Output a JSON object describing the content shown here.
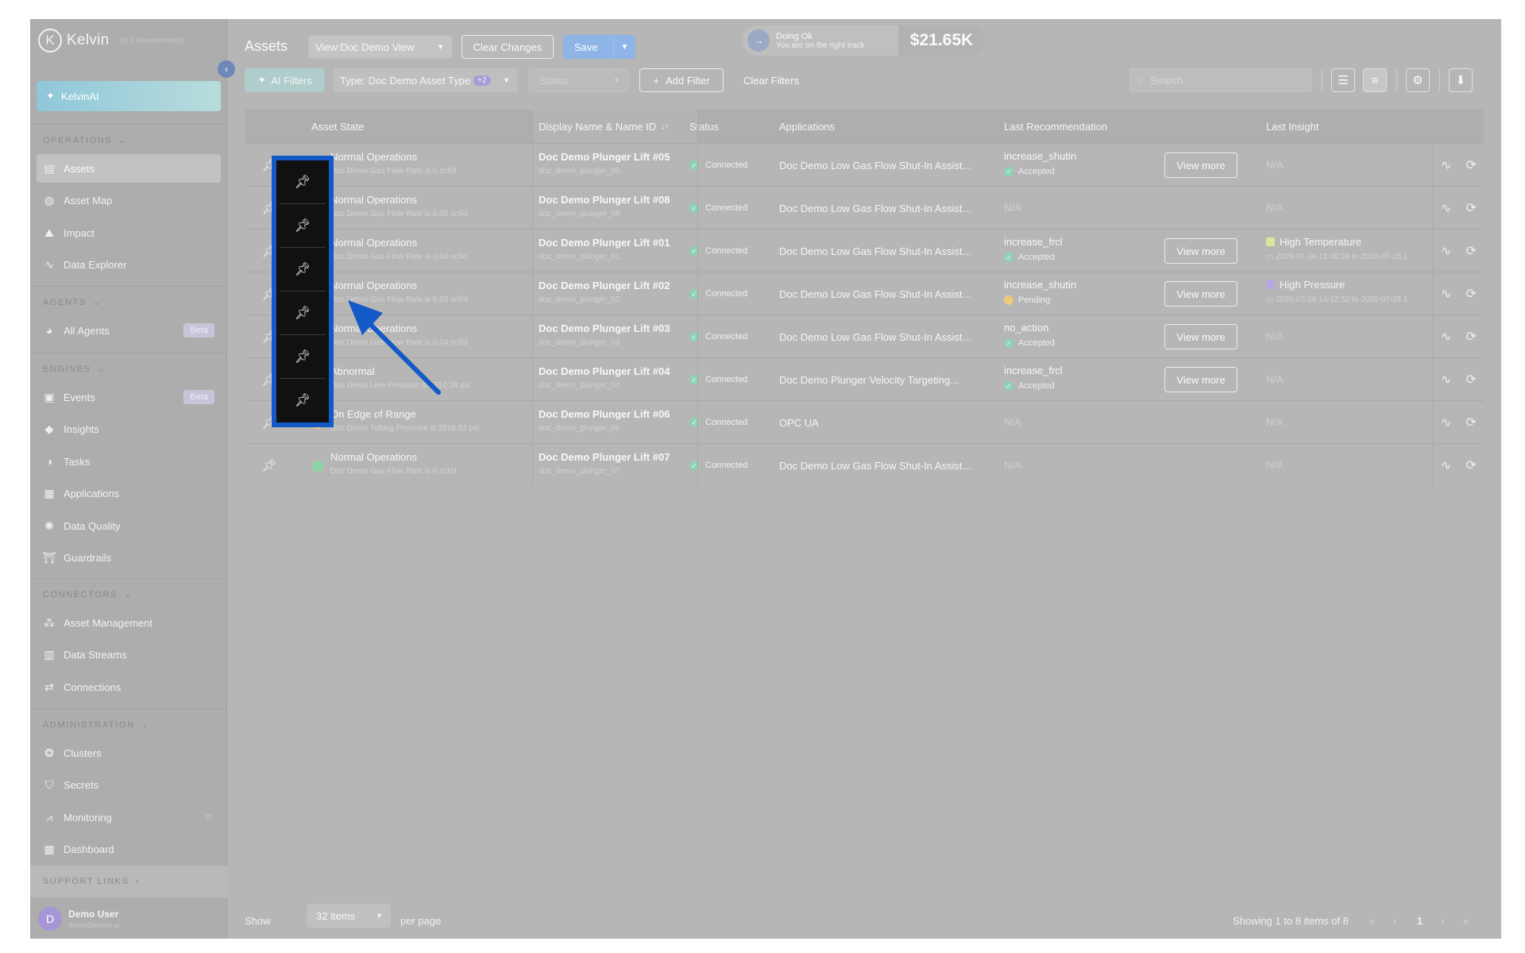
{
  "sidebar": {
    "logo": "Kelvin",
    "logo_sub": "(4.0 Environment)",
    "kelvinai": "KelvinAI",
    "sections": {
      "operations": "OPERATIONS",
      "agents": "AGENTS",
      "engines": "ENGINES",
      "connectors": "CONNECTORS",
      "administration": "ADMINISTRATION",
      "support": "SUPPORT LINKS"
    },
    "items": {
      "assets": "Assets",
      "asset_map": "Asset Map",
      "impact": "Impact",
      "data_explorer": "Data Explorer",
      "all_agents": "All Agents",
      "events": "Events",
      "insights": "Insights",
      "tasks": "Tasks",
      "applications": "Applications",
      "data_quality": "Data Quality",
      "guardrails": "Guardrails",
      "asset_management": "Asset Management",
      "data_streams": "Data Streams",
      "connections": "Connections",
      "clusters": "Clusters",
      "secrets": "Secrets",
      "monitoring": "Monitoring",
      "dashboard": "Dashboard"
    },
    "beta": "Beta",
    "user": {
      "initial": "D",
      "name": "Demo User",
      "email": "demo@kelvin.ai"
    }
  },
  "header": {
    "title": "Assets",
    "view_label": "View:",
    "view_value": "Doc Demo View",
    "clear_changes": "Clear Changes",
    "save": "Save",
    "status_title": "Doing Ok",
    "status_sub": "You are on the right track",
    "amount": "$21.65K"
  },
  "filters": {
    "ai": "AI Filters",
    "type_label": "Type:",
    "type_value": "Doc Demo Asset Type",
    "type_count": "+2",
    "status_placeholder": "Status",
    "add": "Add Filter",
    "clear": "Clear Filters",
    "search_placeholder": "Search"
  },
  "table": {
    "columns": {
      "state": "Asset State",
      "name": "Display Name & Name ID",
      "sort": "↓↑",
      "status": "Status",
      "apps": "Applications",
      "rec": "Last Recommendation",
      "insight": "Last Insight"
    },
    "view_more": "View more",
    "rows": [
      {
        "state": "Normal Operations",
        "state_detail": "Doc Demo Gas Flow Rate is 0 scf/d",
        "dot": "#8fd3a8",
        "name": "Doc Demo Plunger Lift #05",
        "id": "doc_demo_plunger_05",
        "status": "Connected",
        "app": "Doc Demo Low Gas Flow Shut-In Assist...",
        "rec": "increase_shutin",
        "rec_status": "Accepted",
        "rec_pending": false,
        "insight": "N/A",
        "insight_detail": "",
        "insight_color": ""
      },
      {
        "state": "Normal Operations",
        "state_detail": "Doc Demo Gas Flow Rate is 0.05 scf/d",
        "dot": "#8fd3a8",
        "name": "Doc Demo Plunger Lift #08",
        "id": "doc_demo_plunger_08",
        "status": "Connected",
        "app": "Doc Demo Low Gas Flow Shut-In Assist...",
        "rec": "N/A",
        "rec_status": "",
        "rec_pending": false,
        "insight": "N/A",
        "insight_detail": "",
        "insight_color": ""
      },
      {
        "state": "Normal Operations",
        "state_detail": "Doc Demo Gas Flow Rate is 0.04 scf/d",
        "dot": "#8fd3a8",
        "name": "Doc Demo Plunger Lift #01",
        "id": "doc_demo_plunger_01",
        "status": "Connected",
        "app": "Doc Demo Low Gas Flow Shut-In Assist...",
        "rec": "increase_frcl",
        "rec_status": "Accepted",
        "rec_pending": false,
        "insight": "High Temperature",
        "insight_detail": "2026-07-26 12:40:24 to 2026-07-26 1",
        "insight_color": "#d6e79a"
      },
      {
        "state": "Normal Operations",
        "state_detail": "Doc Demo Gas Flow Rate is 0.09 scf/d",
        "dot": "#8fd3a8",
        "name": "Doc Demo Plunger Lift #02",
        "id": "doc_demo_plunger_02",
        "status": "Connected",
        "app": "Doc Demo Low Gas Flow Shut-In Assist...",
        "rec": "increase_shutin",
        "rec_status": "Pending",
        "rec_pending": true,
        "insight": "High Pressure",
        "insight_detail": "2026-07-26 14:12:52 to 2026-07-26 1",
        "insight_color": "#b7a8e0"
      },
      {
        "state": "Normal Operations",
        "state_detail": "Doc Demo Gas Flow Rate is 0.04 scf/d",
        "dot": "#8fd3a8",
        "name": "Doc Demo Plunger Lift #03",
        "id": "doc_demo_plunger_03",
        "status": "Connected",
        "app": "Doc Demo Low Gas Flow Shut-In Assist...",
        "rec": "no_action",
        "rec_status": "Accepted",
        "rec_pending": false,
        "insight": "N/A",
        "insight_detail": "",
        "insight_color": ""
      },
      {
        "state": "Abnormal",
        "state_detail": "Doc Demo Line Pressure is 1310.38 psi",
        "dot": "#e8a3a0",
        "name": "Doc Demo Plunger Lift #04",
        "id": "doc_demo_plunger_04",
        "status": "Connected",
        "app": "Doc Demo Plunger Velocity Targeting...",
        "rec": "increase_frcl",
        "rec_status": "Accepted",
        "rec_pending": false,
        "insight": "N/A",
        "insight_detail": "",
        "insight_color": ""
      },
      {
        "state": "On Edge of Range",
        "state_detail": "Doc Demo Tubing Pressure is 2616.53 psi",
        "dot": "#ecc87a",
        "name": "Doc Demo Plunger Lift #06",
        "id": "doc_demo_plunger_06",
        "status": "Connected",
        "app": "OPC UA",
        "rec": "N/A",
        "rec_status": "",
        "rec_pending": false,
        "insight": "N/A",
        "insight_detail": "",
        "insight_color": ""
      },
      {
        "state": "Normal Operations",
        "state_detail": "Doc Demo Gas Flow Rate is 0 scf/d",
        "dot": "#8fd3a8",
        "name": "Doc Demo Plunger Lift #07",
        "id": "doc_demo_plunger_07",
        "status": "Connected",
        "app": "Doc Demo Low Gas Flow Shut-In Assist...",
        "rec": "N/A",
        "rec_status": "",
        "rec_pending": false,
        "insight": "N/A",
        "insight_detail": "",
        "insight_color": ""
      }
    ]
  },
  "footer": {
    "show": "Show",
    "per_page_value": "32 items",
    "per_page": "per page",
    "showing": "Showing 1 to 8 items of 8",
    "page": "1"
  },
  "icons": {
    "pin": "pin-icon",
    "pulse": "pulse-icon",
    "sync": "sync-settings-icon"
  },
  "colors": {
    "highlight": "#1359c7",
    "arrow": "#1359c7"
  }
}
